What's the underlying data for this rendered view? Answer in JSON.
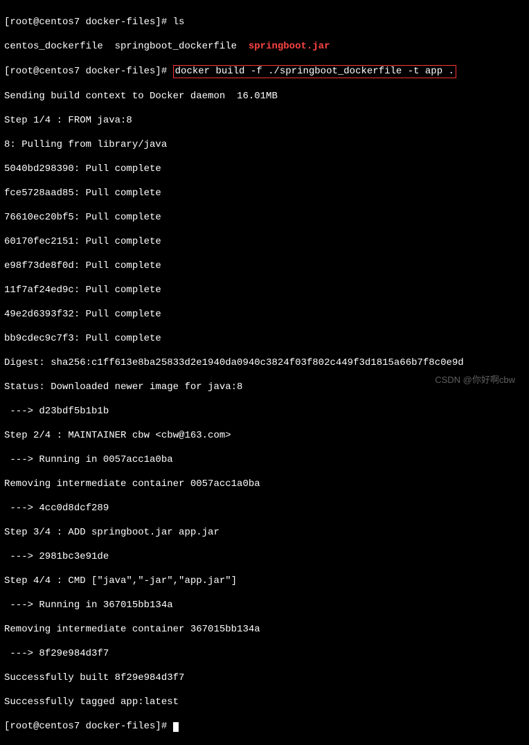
{
  "prompt1": "[root@centos7 docker-files]# ",
  "cmd_ls": "ls",
  "ls_output_prefix": "centos_dockerfile  springboot_dockerfile  ",
  "ls_output_jar": "springboot.jar",
  "prompt2": "[root@centos7 docker-files]# ",
  "cmd_build": "docker build -f ./springboot_dockerfile -t app .",
  "lines": [
    "Sending build context to Docker daemon  16.01MB",
    "Step 1/4 : FROM java:8",
    "8: Pulling from library/java",
    "5040bd298390: Pull complete",
    "fce5728aad85: Pull complete",
    "76610ec20bf5: Pull complete",
    "60170fec2151: Pull complete",
    "e98f73de8f0d: Pull complete",
    "11f7af24ed9c: Pull complete",
    "49e2d6393f32: Pull complete",
    "bb9cdec9c7f3: Pull complete",
    "Digest: sha256:c1ff613e8ba25833d2e1940da0940c3824f03f802c449f3d1815a66b7f8c0e9d",
    "Status: Downloaded newer image for java:8",
    " ---> d23bdf5b1b1b",
    "Step 2/4 : MAINTAINER cbw <cbw@163.com>",
    " ---> Running in 0057acc1a0ba",
    "Removing intermediate container 0057acc1a0ba",
    " ---> 4cc0d8dcf289",
    "Step 3/4 : ADD springboot.jar app.jar",
    " ---> 2981bc3e91de",
    "Step 4/4 : CMD [\"java\",\"-jar\",\"app.jar\"]",
    " ---> Running in 367015bb134a",
    "Removing intermediate container 367015bb134a",
    " ---> 8f29e984d3f7",
    "Successfully built 8f29e984d3f7",
    "Successfully tagged app:latest"
  ],
  "prompt3": "[root@centos7 docker-files]# ",
  "watermark": "CSDN @你好啊cbw"
}
